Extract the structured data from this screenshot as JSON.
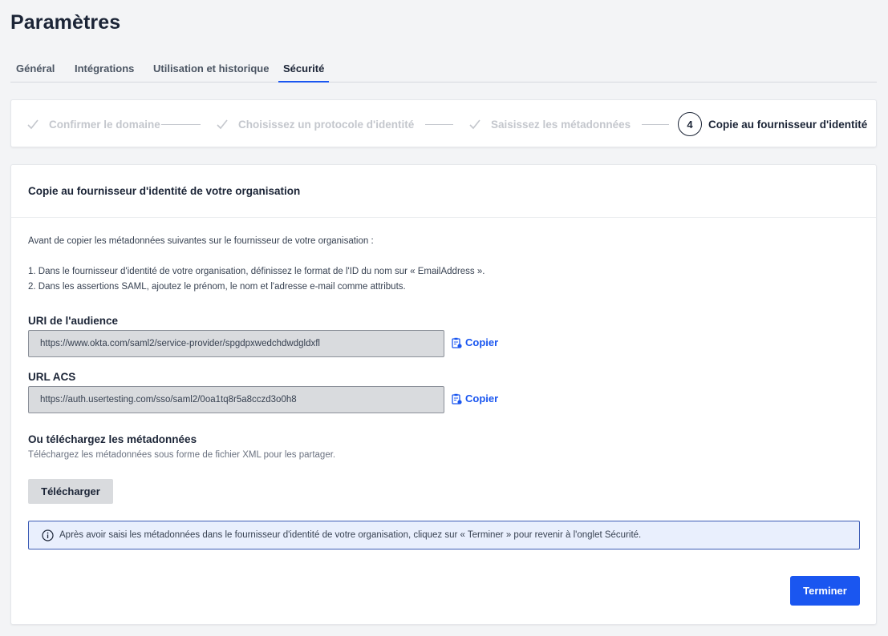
{
  "page": {
    "title": "Paramètres"
  },
  "tabs": [
    {
      "label": "Général"
    },
    {
      "label": "Intégrations"
    },
    {
      "label": "Utilisation et historique"
    },
    {
      "label": "Sécurité",
      "active": true
    }
  ],
  "stepper": {
    "steps": [
      {
        "label": "Confirmer le domaine",
        "state": "done"
      },
      {
        "label": "Choisissez un protocole d'identité",
        "state": "done"
      },
      {
        "label": "Saisissez les métadonnées",
        "state": "done"
      },
      {
        "number": "4",
        "label": "Copie au fournisseur d'identité",
        "state": "current"
      }
    ]
  },
  "card": {
    "title": "Copie au fournisseur d'identité de votre organisation",
    "intro": "Avant de copier les métadonnées suivantes sur le fournisseur de votre organisation :",
    "instructions": [
      "1. Dans le fournisseur d'identité de votre organisation, définissez le format de l'ID du nom sur « EmailAddress ».",
      "2. Dans les assertions SAML, ajoutez le prénom, le nom et l'adresse e-mail comme attributs."
    ],
    "audience": {
      "label": "URI de l'audience",
      "value": "https://www.okta.com/saml2/service-provider/spgdpxwedchdwdgldxfl",
      "copy_label": "Copier"
    },
    "acs": {
      "label": "URL ACS",
      "value": "https://auth.usertesting.com/sso/saml2/0oa1tq8r5a8cczd3o0h8",
      "copy_label": "Copier"
    },
    "download": {
      "title": "Ou téléchargez les métadonnées",
      "subtitle": "Téléchargez les métadonnées sous forme de fichier XML pour les partager.",
      "button_label": "Télécharger"
    },
    "info_text": "Après avoir saisi les métadonnées dans le fournisseur d'identité de votre organisation, cliquez sur « Terminer » pour revenir à l'onglet Sécurité.",
    "finish_label": "Terminer"
  },
  "colors": {
    "accent": "#1a56f0",
    "info_bg": "#e9effd",
    "info_border": "#3b5bb5"
  },
  "icons": {
    "step_done": "check-icon",
    "copy": "clipboard-icon",
    "info": "info-icon"
  }
}
